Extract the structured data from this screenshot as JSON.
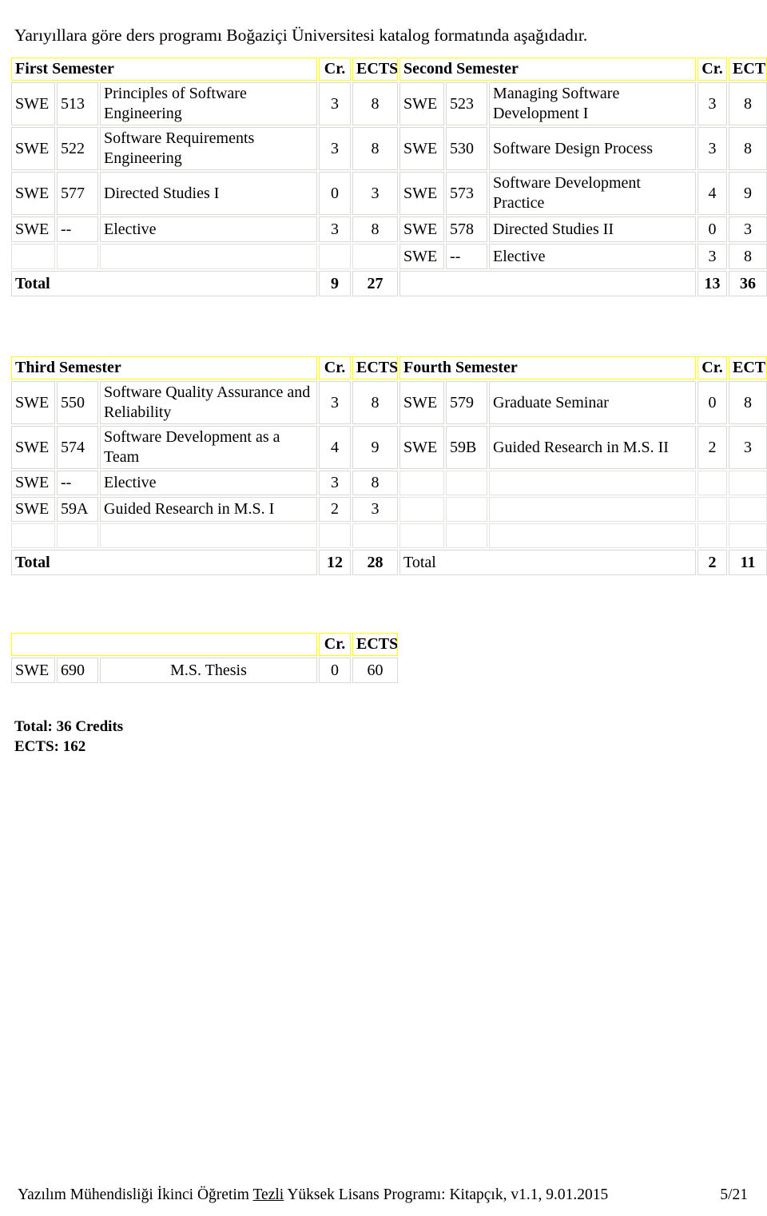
{
  "intro": {
    "text": "Yarıyıllara göre ders programı Boğaziçi Üniversitesi katalog formatında aşağıdadır."
  },
  "columns": {
    "cr": "Cr.",
    "ects": "ECTS"
  },
  "semester_1": {
    "header": "First Semester",
    "rows": [
      {
        "dept": "SWE",
        "code": "513",
        "title": "Principles of Software Engineering",
        "cr": "3",
        "ects": "8"
      },
      {
        "dept": "SWE",
        "code": "522",
        "title": "Software Requirements Engineering",
        "cr": "3",
        "ects": "8"
      },
      {
        "dept": "SWE",
        "code": "577",
        "title": "Directed Studies I",
        "cr": "0",
        "ects": "3"
      },
      {
        "dept": "SWE",
        "code": "--",
        "title": "Elective",
        "cr": "3",
        "ects": "8"
      },
      {
        "dept": "",
        "code": "",
        "title": "",
        "cr": "",
        "ects": ""
      }
    ],
    "total_label": "Total",
    "total_cr": "9",
    "total_ects": "27"
  },
  "semester_2": {
    "header": "Second Semester",
    "rows": [
      {
        "dept": "SWE",
        "code": "523",
        "title": "Managing Software Development I",
        "cr": "3",
        "ects": "8"
      },
      {
        "dept": "SWE",
        "code": "530",
        "title": "Software Design Process",
        "cr": "3",
        "ects": "8"
      },
      {
        "dept": "SWE",
        "code": "573",
        "title": "Software Development Practice",
        "cr": "4",
        "ects": "9"
      },
      {
        "dept": "SWE",
        "code": "578",
        "title": "Directed Studies II",
        "cr": "0",
        "ects": "3"
      },
      {
        "dept": "SWE",
        "code": "--",
        "title": "Elective",
        "cr": "3",
        "ects": "8"
      }
    ],
    "total_label": "",
    "total_cr": "13",
    "total_ects": "36"
  },
  "semester_3": {
    "header": "Third Semester",
    "rows": [
      {
        "dept": "SWE",
        "code": "550",
        "title": "Software Quality Assurance and Reliability",
        "cr": "3",
        "ects": "8"
      },
      {
        "dept": "SWE",
        "code": "574",
        "title": "Software Development as a Team",
        "cr": "4",
        "ects": "9"
      },
      {
        "dept": "SWE",
        "code": "--",
        "title": "Elective",
        "cr": "3",
        "ects": "8"
      },
      {
        "dept": "SWE",
        "code": "59A",
        "title": "Guided Research in M.S. I",
        "cr": "2",
        "ects": "3"
      },
      {
        "dept": "",
        "code": "",
        "title": "",
        "cr": "",
        "ects": ""
      }
    ],
    "total_label": "Total",
    "total_cr": "12",
    "total_ects": "28"
  },
  "semester_4": {
    "header": "Fourth Semester",
    "rows": [
      {
        "dept": "SWE",
        "code": "579",
        "title": "Graduate Seminar",
        "cr": "0",
        "ects": "8"
      },
      {
        "dept": "SWE",
        "code": "59B",
        "title": "Guided Research in M.S. II",
        "cr": "2",
        "ects": "3"
      },
      {
        "dept": "",
        "code": "",
        "title": "",
        "cr": "",
        "ects": ""
      },
      {
        "dept": "",
        "code": "",
        "title": "",
        "cr": "",
        "ects": ""
      },
      {
        "dept": "",
        "code": "",
        "title": "",
        "cr": "",
        "ects": ""
      }
    ],
    "total_label": "Total",
    "total_cr": "2",
    "total_ects": "11"
  },
  "thesis": {
    "header": "",
    "row": {
      "dept": "SWE",
      "code": "690",
      "title": "M.S. Thesis",
      "cr": "0",
      "ects": "60"
    }
  },
  "totals": {
    "credits": "Total: 36 Credits",
    "ects": "ECTS: 162"
  },
  "footer": {
    "part1": "Yazılım Mühendisliği İkinci Öğretim ",
    "underlined": "Tezli",
    "part2": " Yüksek Lisans Programı: Kitapçık, v1.1, 9.01.2015",
    "page": "5/21"
  },
  "colors": {
    "header_highlight": "#FFFF00",
    "text": "#000000",
    "border": "#D9D9D4",
    "background": "#FFFFFF"
  }
}
